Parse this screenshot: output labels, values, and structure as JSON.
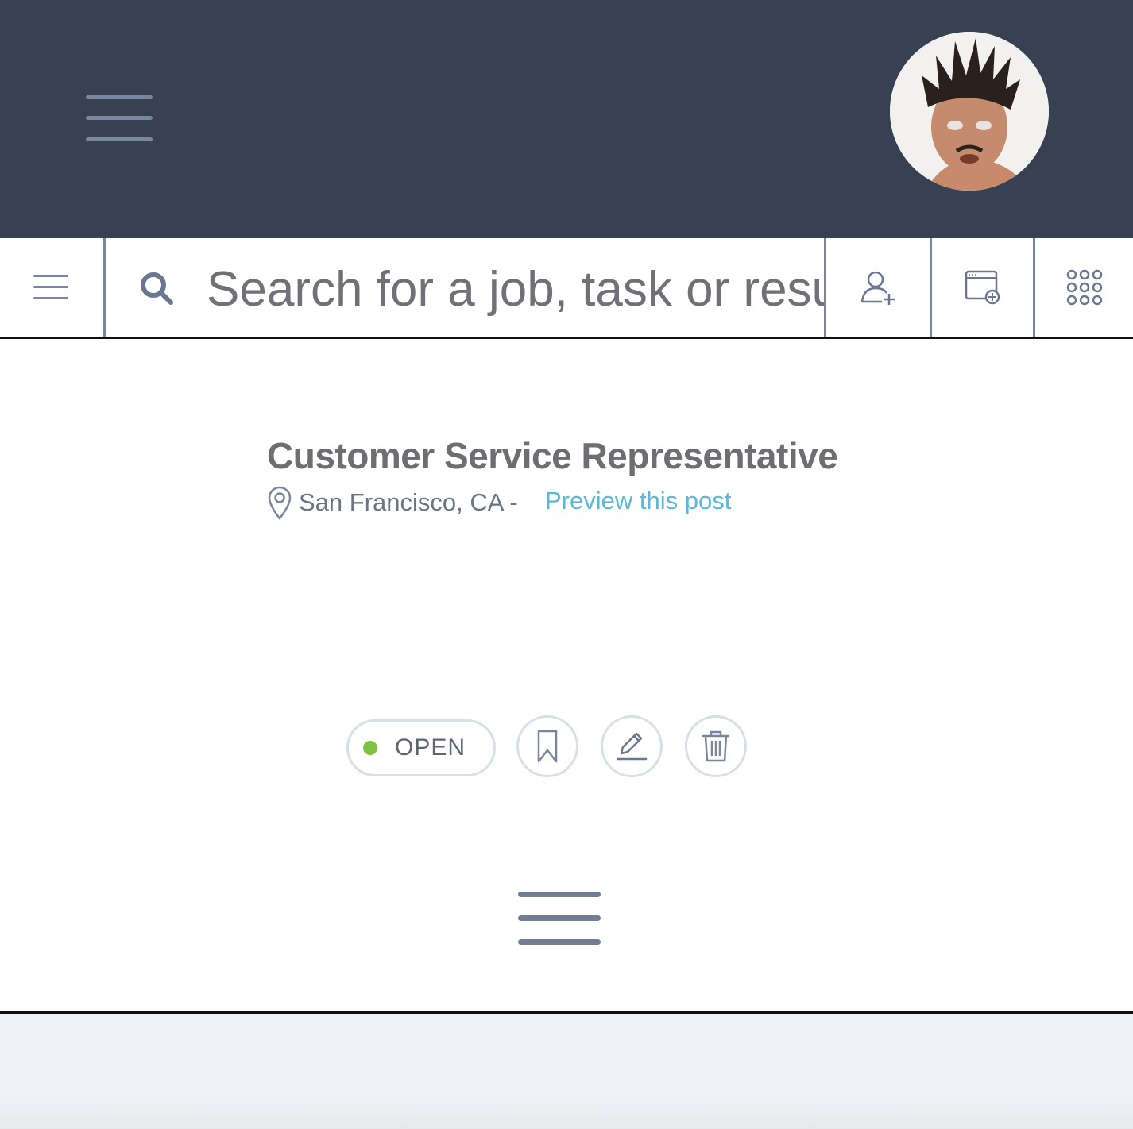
{
  "header": {
    "menu_icon": "hamburger-menu-icon",
    "avatar_icon": "user-avatar",
    "background_color": "#384152"
  },
  "toolbar": {
    "menu_icon": "hamburger-menu-icon",
    "search": {
      "icon": "search-icon",
      "placeholder": "Search for a job, task or resume",
      "value": ""
    },
    "actions": [
      {
        "icon": "add-user-icon"
      },
      {
        "icon": "new-window-icon"
      },
      {
        "icon": "app-grid-icon"
      }
    ]
  },
  "job": {
    "title": "Customer Service Representative",
    "location": "San Francisco, CA -",
    "location_icon": "map-pin-icon",
    "preview_link": "Preview this post",
    "status": {
      "label": "OPEN",
      "color": "#7ec242"
    },
    "actions": [
      {
        "icon": "bookmark-icon"
      },
      {
        "icon": "edit-icon"
      },
      {
        "icon": "trash-icon"
      }
    ]
  },
  "bottom_menu_icon": "hamburger-menu-icon",
  "colors": {
    "accent_link": "#5ab8d8",
    "icon_gray": "#7a86a0",
    "status_open": "#7ec242"
  }
}
